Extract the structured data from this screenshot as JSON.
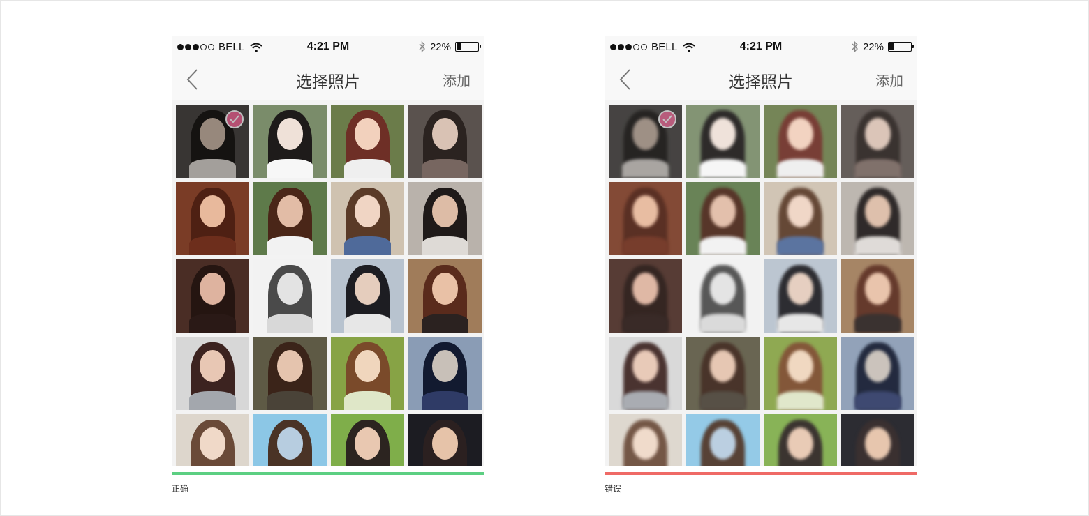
{
  "statusbar": {
    "carrier": "BELL",
    "time": "4:21 PM",
    "battery": "22%",
    "battery_level": 0.22,
    "signal_bars_filled": 3,
    "signal_bars_total": 5
  },
  "navbar": {
    "back_icon": "chevron-left-icon",
    "title": "选择照片",
    "add_label": "添加"
  },
  "grid": {
    "rows": 5,
    "columns": 4,
    "selected_index": 0,
    "thumbnails": [
      {
        "bg": "#4a4744",
        "hair": "#1c1917",
        "face": "#c9b5a6",
        "body": "#d9d4cf"
      },
      {
        "bg": "#7a8c6a",
        "hair": "#1e1b1a",
        "face": "#efe1d8",
        "body": "#f7f7f7"
      },
      {
        "bg": "#6b7c4a",
        "hair": "#6e2f26",
        "face": "#f2d1bd",
        "body": "#efefef"
      },
      {
        "bg": "#5a524e",
        "hair": "#2b2320",
        "face": "#d9c2b4",
        "body": "#776660"
      },
      {
        "bg": "#7a3c26",
        "hair": "#4e2013",
        "face": "#e8b99c",
        "body": "#6d2e1c"
      },
      {
        "bg": "#5e7a4a",
        "hair": "#4a2618",
        "face": "#e2bca6",
        "body": "#f2f2f2"
      },
      {
        "bg": "#cfc2b0",
        "hair": "#5a3a27",
        "face": "#f0d5c4",
        "body": "#4f6a9a"
      },
      {
        "bg": "#b9b2ab",
        "hair": "#1f1a19",
        "face": "#ddbca6",
        "body": "#dedad6"
      },
      {
        "bg": "#4a2d25",
        "hair": "#251511",
        "face": "#deb39f",
        "body": "#2a1916"
      },
      {
        "bg": "#f2f2f2",
        "hair": "#4a4a4a",
        "face": "#e3e3e3",
        "body": "#d8d8d8"
      },
      {
        "bg": "#b8c3cf",
        "hair": "#1d1d22",
        "face": "#e5cdbd",
        "body": "#e7e7e7"
      },
      {
        "bg": "#a07c5a",
        "hair": "#5a2b1c",
        "face": "#e9c1a6",
        "body": "#2b2220"
      },
      {
        "bg": "#d7d7d7",
        "hair": "#3c2320",
        "face": "#e8c7b4",
        "body": "#a3a7ad"
      },
      {
        "bg": "#5e5a45",
        "hair": "#3b2419",
        "face": "#e5c4ae",
        "body": "#4a4338"
      },
      {
        "bg": "#87a345",
        "hair": "#7a4a2a",
        "face": "#f0d6bd",
        "body": "#dfe7c8"
      },
      {
        "bg": "#8a9cb5",
        "hair": "#121a30",
        "face": "#c8c0b8",
        "body": "#2f3b66"
      },
      {
        "bg": "#ddd6cc",
        "hair": "#6a4a38",
        "face": "#f0d9c8",
        "body": "#f4eee4"
      },
      {
        "bg": "#8cc7e6",
        "hair": "#4a3326",
        "face": "#b7cde0",
        "body": "#7fb5d6"
      },
      {
        "bg": "#7fae4a",
        "hair": "#2c2420",
        "face": "#e9c8b1",
        "body": "#f4f4f4"
      },
      {
        "bg": "#1c1c22",
        "hair": "#2b2020",
        "face": "#e6c3a9",
        "body": "#c9a790"
      }
    ]
  },
  "examples": {
    "correct_label": "正确",
    "wrong_label": "错误",
    "correct_color": "#5ccf82",
    "wrong_color": "#ef6a66",
    "check_color": "#f06a98"
  }
}
